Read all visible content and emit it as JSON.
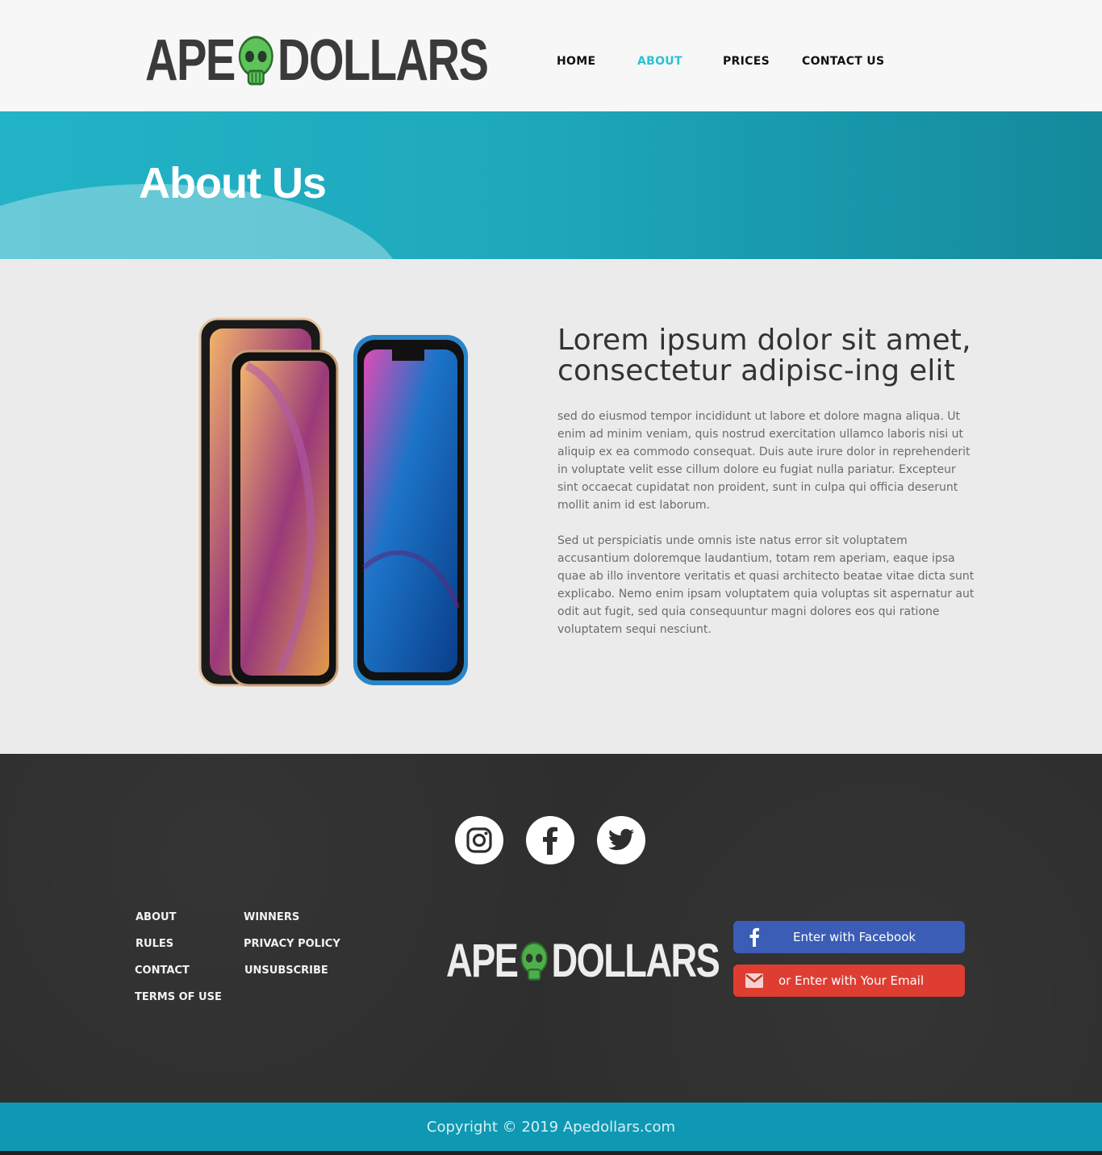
{
  "header": {
    "logo_left": "APE",
    "logo_right": "DOLLARS",
    "nav": [
      {
        "label": "HOME",
        "active": false
      },
      {
        "label": "ABOUT",
        "active": true
      },
      {
        "label": "PRICES",
        "active": false
      },
      {
        "label": "CONTACT US",
        "active": false
      }
    ]
  },
  "hero": {
    "title": "About Us"
  },
  "article": {
    "heading": "Lorem ipsum dolor sit amet, consectetur adipisc-ing elit",
    "paragraphs": [
      "sed do eiusmod tempor incididunt ut labore et dolore magna aliqua. Ut enim ad minim veniam, quis nostrud exercitation ullamco laboris nisi ut aliquip ex ea commodo consequat. Duis aute irure dolor in reprehenderit in voluptate velit esse cillum dolore eu fugiat nulla pariatur. Excepteur sint occaecat cupidatat non proident, sunt in culpa qui officia deserunt mollit anim id est laborum.",
      "Sed ut perspiciatis unde omnis iste natus error sit voluptatem accusantium doloremque laudantium, totam rem aperiam, eaque ipsa quae ab illo inventore veritatis et quasi architecto beatae vitae dicta sunt explicabo. Nemo enim ipsam voluptatem quia voluptas sit aspernatur aut odit aut fugit, sed quia consequuntur magni dolores eos qui ratione voluptatem sequi nesciunt."
    ]
  },
  "footer": {
    "social": [
      "instagram-icon",
      "facebook-icon",
      "twitter-icon"
    ],
    "links": [
      "ABOUT",
      "RULES",
      "CONTACT",
      "TERMS OF USE",
      "WINNERS",
      "PRIVACY POLICY",
      "UNSUBSCRIBE"
    ],
    "logo_left": "APE",
    "logo_right": "DOLLARS",
    "facebook_button": "Enter with Facebook",
    "email_button": "or Enter with Your Email",
    "copyright": "Copyright © 2019 Apedollars.com"
  },
  "colors": {
    "accent": "#29c1d6",
    "hero": "#1fa9bd",
    "footer": "#2e2e2e",
    "facebook": "#3b5db5",
    "email": "#e03d32",
    "copyright_bar": "#0e98b3"
  }
}
